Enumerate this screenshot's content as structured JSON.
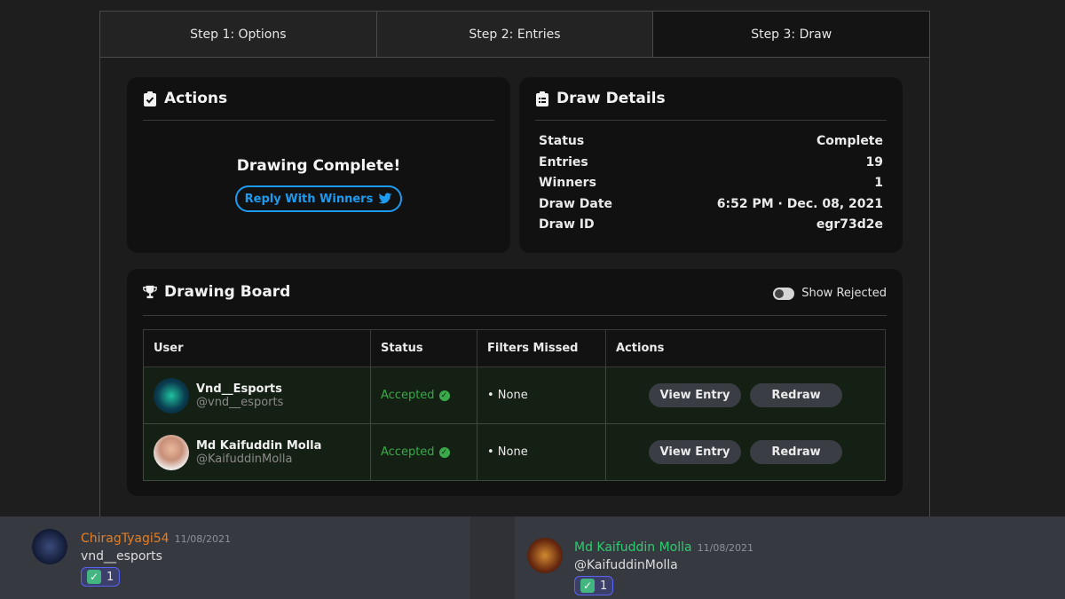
{
  "steps": [
    "Step 1: Options",
    "Step 2: Entries",
    "Step 3: Draw"
  ],
  "actions": {
    "title": "Actions",
    "status_text": "Drawing Complete!",
    "reply_label": "Reply With Winners"
  },
  "details": {
    "title": "Draw Details",
    "rows": [
      {
        "label": "Status",
        "value": "Complete"
      },
      {
        "label": "Entries",
        "value": "19"
      },
      {
        "label": "Winners",
        "value": "1"
      },
      {
        "label": "Draw Date",
        "value": "6:52 PM · Dec. 08, 2021"
      },
      {
        "label": "Draw ID",
        "value": "egr73d2e"
      }
    ]
  },
  "board": {
    "title": "Drawing Board",
    "toggle_label": "Show Rejected",
    "columns": [
      "User",
      "Status",
      "Filters Missed",
      "Actions"
    ],
    "rows": [
      {
        "name": "Vnd__Esports",
        "handle": "@vnd__esports",
        "status": "Accepted",
        "filters": "• None",
        "view": "View Entry",
        "redraw": "Redraw"
      },
      {
        "name": "Md Kaifuddin Molla",
        "handle": "@KaifuddinMolla",
        "status": "Accepted",
        "filters": "• None",
        "view": "View Entry",
        "redraw": "Redraw"
      }
    ]
  },
  "discord": {
    "left": {
      "name": "ChiragTyagi54",
      "name_color": "#e67e22",
      "date": "11/08/2021",
      "text": "vnd__esports",
      "reaction_count": "1"
    },
    "right": {
      "name": "Md Kaifuddin Molla",
      "name_color": "#2ecc71",
      "date": "11/08/2021",
      "text": "@KaifuddinMolla",
      "reaction_count": "1"
    }
  },
  "colors": {
    "twitter_blue": "#1d9bf0",
    "accepted_green": "#3aa94a"
  }
}
